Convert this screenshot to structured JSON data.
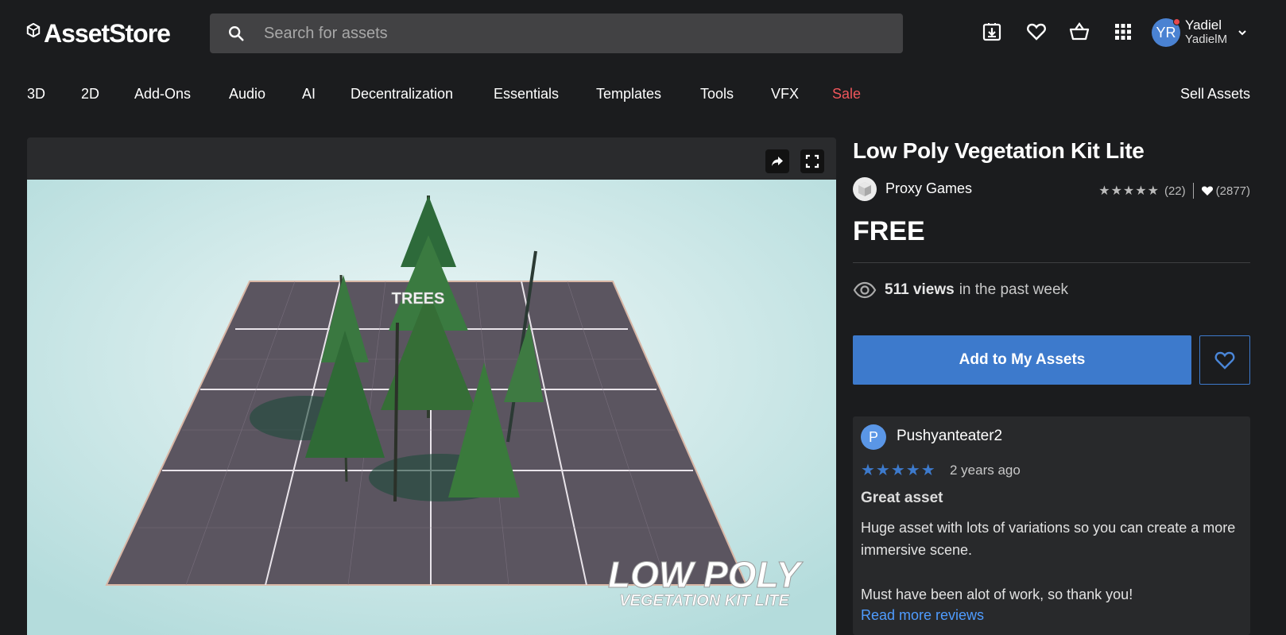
{
  "header": {
    "logo_text": "AssetStore",
    "search_placeholder": "Search for assets",
    "icons": [
      "download-icon",
      "heart-icon",
      "basket-icon",
      "apps-grid-icon"
    ],
    "user": {
      "initials": "YR",
      "display_name": "Yadiel",
      "username": "YadielM"
    }
  },
  "nav": {
    "items": [
      "3D",
      "2D",
      "Add-Ons",
      "Audio",
      "AI",
      "Decentralization",
      "Essentials",
      "Templates",
      "Tools",
      "VFX",
      "Sale"
    ],
    "sell_label": "Sell Assets"
  },
  "gallery": {
    "scene_label": "TREES",
    "overlay_title": "LOW POLY",
    "overlay_subtitle": "VEGETATION KIT LITE"
  },
  "product": {
    "title": "Low Poly Vegetation Kit Lite",
    "publisher": "Proxy Games",
    "rating_stars": "★★★★★",
    "rating_count": "(22)",
    "favorites": "(2877)",
    "price": "FREE",
    "views_count": "511 views",
    "views_suffix": "in the past week",
    "add_button": "Add to My Assets"
  },
  "review": {
    "avatar_letter": "P",
    "author": "Pushyanteater2",
    "stars": "★★★★★",
    "date": "2 years ago",
    "title": "Great asset",
    "body": "Huge asset with lots of variations so you can create a more immersive scene.",
    "body2": "Must have been alot of work, so thank you!",
    "read_more": "Read more reviews"
  },
  "colors": {
    "background": "#1b1c1e",
    "accent": "#3d7acc",
    "sale": "#f0565b",
    "link": "#4f9cff"
  }
}
